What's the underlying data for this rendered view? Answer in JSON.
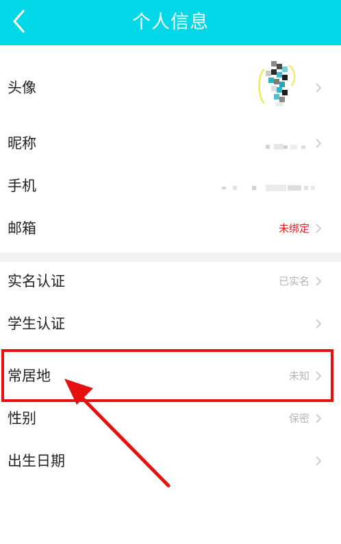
{
  "header": {
    "title": "个人信息",
    "back_icon": "chevron-left-icon",
    "background": "#00d8e8"
  },
  "rows": [
    {
      "key": "avatar",
      "label": "头像",
      "value": ""
    },
    {
      "key": "nickname",
      "label": "昵称",
      "value": ""
    },
    {
      "key": "phone",
      "label": "手机",
      "value": ""
    },
    {
      "key": "email",
      "label": "邮箱",
      "value": "未绑定"
    },
    {
      "key": "realname",
      "label": "实名认证",
      "value": "已实名"
    },
    {
      "key": "student",
      "label": "学生认证",
      "value": ""
    },
    {
      "key": "location",
      "label": "常居地",
      "value": "未知"
    },
    {
      "key": "gender",
      "label": "性别",
      "value": "保密"
    },
    {
      "key": "birthday",
      "label": "出生日期",
      "value": ""
    }
  ],
  "annotation": {
    "color": "#e61010",
    "target": "常居地"
  },
  "colors": {
    "accent": "#00d8e8",
    "warning": "#e02020",
    "muted": "#b5b5b5"
  }
}
